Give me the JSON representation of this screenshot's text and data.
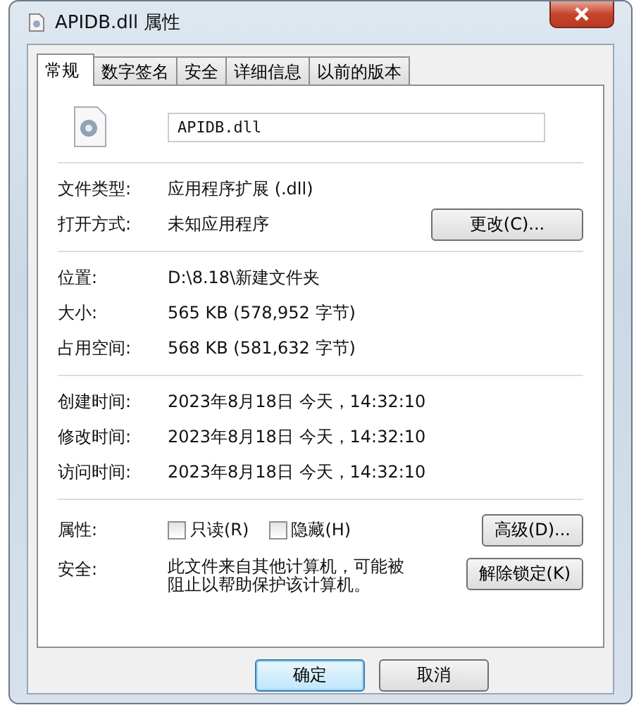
{
  "window": {
    "title": "APIDB.dll 属性"
  },
  "tabs": [
    {
      "label": "常规",
      "selected": true
    },
    {
      "label": "数字签名",
      "selected": false
    },
    {
      "label": "安全",
      "selected": false
    },
    {
      "label": "详细信息",
      "selected": false
    },
    {
      "label": "以前的版本",
      "selected": false
    }
  ],
  "file_name": "APIDB.dll",
  "sections": [
    {
      "rows": [
        {
          "label": "文件类型:",
          "value": "应用程序扩展 (.dll)"
        },
        {
          "label": "打开方式:",
          "value": "未知应用程序",
          "button": "更改(C)..."
        }
      ]
    },
    {
      "rows": [
        {
          "label": "位置:",
          "value": "D:\\8.18\\新建文件夹"
        },
        {
          "label": "大小:",
          "value": "565 KB (578,952 字节)"
        },
        {
          "label": "占用空间:",
          "value": "568 KB (581,632 字节)"
        }
      ]
    },
    {
      "rows": [
        {
          "label": "创建时间:",
          "value": "2023年8月18日 今天，14:32:10"
        },
        {
          "label": "修改时间:",
          "value": "2023年8月18日 今天，14:32:10"
        },
        {
          "label": "访问时间:",
          "value": "2023年8月18日 今天，14:32:10"
        }
      ]
    }
  ],
  "attributes": {
    "label": "属性:",
    "checkboxes": [
      {
        "label": "只读(R)",
        "checked": false
      },
      {
        "label": "隐藏(H)",
        "checked": false
      }
    ],
    "button": "高级(D)..."
  },
  "security": {
    "label": "安全:",
    "text": "此文件来自其他计算机，可能被阻止以帮助保护该计算机。",
    "button": "解除锁定(K)"
  },
  "buttons": [
    {
      "label": "确定",
      "default": true
    },
    {
      "label": "取消",
      "default": false
    }
  ]
}
